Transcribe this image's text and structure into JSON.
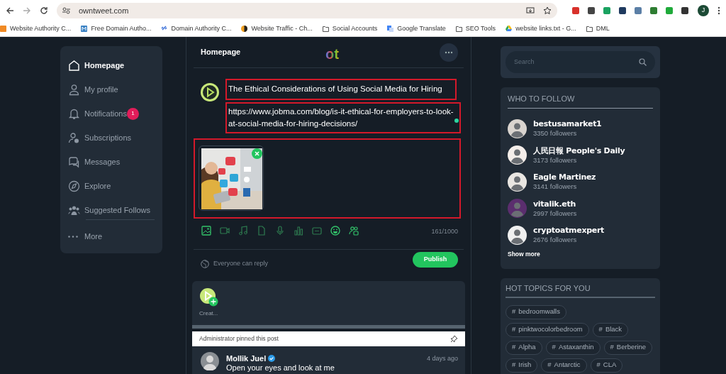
{
  "browser": {
    "url": "owntweet.com",
    "bookmarks": [
      {
        "label": "Website Authority C..."
      },
      {
        "label": "Free Domain Autho..."
      },
      {
        "label": "Domain Authority C..."
      },
      {
        "label": "Website Traffic - Ch..."
      },
      {
        "label": "Social Accounts"
      },
      {
        "label": "Google Translate"
      },
      {
        "label": "SEO Tools"
      },
      {
        "label": "website links.txt - G..."
      },
      {
        "label": "DML"
      }
    ],
    "profile_initial": "J"
  },
  "sidebar": {
    "items": [
      {
        "label": "Homepage",
        "selected": true
      },
      {
        "label": "My profile",
        "selected": false
      },
      {
        "label": "Notifications",
        "selected": false,
        "badge": "1"
      },
      {
        "label": "Subscriptions",
        "selected": false
      },
      {
        "label": "Messages",
        "selected": false
      },
      {
        "label": "Explore",
        "selected": false
      },
      {
        "label": "Suggested Follows",
        "selected": false
      },
      {
        "label": "More",
        "selected": false
      }
    ]
  },
  "header": {
    "title": "Homepage",
    "logo": "ot"
  },
  "composer": {
    "title": {
      "value": "The Ethical Considerations of Using Social Media for Hiring",
      "highlighted": true
    },
    "url": {
      "value": "https://www.jobma.com/blog/is-it-ethical-for-employers-to-look-at-social-media-for-hiring-decisions/",
      "highlighted": true
    },
    "media": {
      "kind": "picture",
      "highlighted": true
    },
    "counter": "161/1000",
    "reply_setting": "Everyone can reply",
    "publish": "Publish"
  },
  "stories": {
    "create_label": "Creat..."
  },
  "pinned_notice": "Administrator pinned this post",
  "post": {
    "author": "Mollik Juel",
    "verified": true,
    "time": "4 days ago",
    "text": "Open your eyes and look at me"
  },
  "search": {
    "placeholder": "Search"
  },
  "who_to_follow": {
    "title": "WHO TO FOLLOW",
    "users": [
      {
        "name": "bestusamarket1",
        "followers": "3350 followers"
      },
      {
        "name": "人民日報 People's Daily",
        "followers": "3173 followers"
      },
      {
        "name": "Eagle Martinez",
        "followers": "3141 followers"
      },
      {
        "name": "vitalik.eth",
        "followers": "2997 followers"
      },
      {
        "name": "cryptoatmexpert",
        "followers": "2676 followers"
      }
    ],
    "show_more": "Show more"
  },
  "hot_topics": {
    "title": "HOT TOPICS FOR YOU",
    "rows": [
      [
        {
          "hash": "#",
          "tag": "bedroomwalls"
        }
      ],
      [
        {
          "hash": "#",
          "tag": "pinktwocolorbedroom"
        },
        {
          "hash": "#",
          "tag": "Black"
        }
      ],
      [
        {
          "hash": "#",
          "tag": "Alpha"
        },
        {
          "hash": "#",
          "tag": "Astaxanthin"
        },
        {
          "hash": "#",
          "tag": "Berberine"
        }
      ],
      [
        {
          "hash": "#",
          "tag": "Irish"
        },
        {
          "hash": "#",
          "tag": "Antarctic"
        },
        {
          "hash": "#",
          "tag": "CLA"
        }
      ]
    ]
  }
}
